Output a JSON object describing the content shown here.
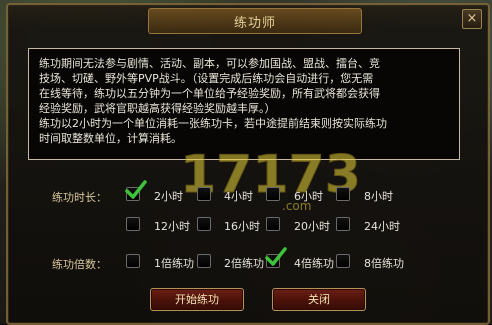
{
  "window": {
    "title": "练功师",
    "close_glyph": "×"
  },
  "description": {
    "text": "练功期间无法参与剧情、活动、副本，可以参加国战、盟战、擂台、竞\n技场、切磋、野外等PVP战斗。（设置完成后练功会自动进行，您无需\n在线等待，练功以五分钟为一个单位给予经验奖励，所有武将都会获得\n经验奖励，武将官职越高获得经验奖励越丰厚。）\n练功以2小时为一个单位消耗一张练功卡，若中途提前结束则按实际练功\n时间取整数单位，计算消耗。"
  },
  "duration": {
    "label": "练功时长：",
    "options": [
      {
        "label": "2小时",
        "checked": true
      },
      {
        "label": "4小时",
        "checked": false
      },
      {
        "label": "6小时",
        "checked": false
      },
      {
        "label": "8小时",
        "checked": false
      },
      {
        "label": "12小时",
        "checked": false
      },
      {
        "label": "16小时",
        "checked": false
      },
      {
        "label": "20小时",
        "checked": false
      },
      {
        "label": "24小时",
        "checked": false
      }
    ]
  },
  "multiplier": {
    "label": "练功倍数：",
    "options": [
      {
        "label": "1倍练功",
        "checked": false
      },
      {
        "label": "2倍练功",
        "checked": false
      },
      {
        "label": "4倍练功",
        "checked": true
      },
      {
        "label": "8倍练功",
        "checked": false
      }
    ]
  },
  "buttons": {
    "start": "开始练功",
    "close": "关闭"
  },
  "watermark": "17173.com",
  "colors": {
    "accent_gold": "#7a6338",
    "check_green": "#3cc43a",
    "button_red": "#6b1f14"
  }
}
